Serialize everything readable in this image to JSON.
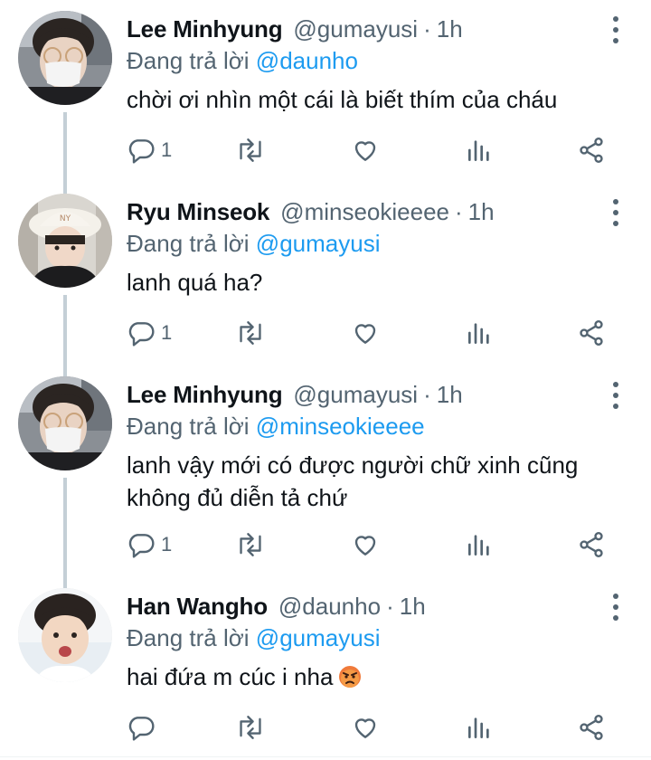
{
  "reply_prefix": "Đang trả lời",
  "dot": "·",
  "tweets": [
    {
      "name": "Lee Minhyung",
      "handle": "@gumayusi",
      "time": "1h",
      "reply_to": "@daunho",
      "text": "chời ơi nhìn một cái là biết thím của cháu",
      "reply_count": "1",
      "avatar": "photo-masked-glasses"
    },
    {
      "name": "Ryu Minseok",
      "handle": "@minseokieeee",
      "time": "1h",
      "reply_to": "@gumayusi",
      "text": "lanh quá ha?",
      "reply_count": "1",
      "avatar": "photo-bucket-hat"
    },
    {
      "name": "Lee Minhyung",
      "handle": "@gumayusi",
      "time": "1h",
      "reply_to": "@minseokieeee",
      "text": "lanh vậy mới có được người chữ xinh cũng không đủ diễn tả chứ",
      "reply_count": "1",
      "avatar": "photo-masked-glasses"
    },
    {
      "name": "Han Wangho",
      "handle": "@daunho",
      "time": "1h",
      "reply_to": "@gumayusi",
      "text": "hai đứa m cúc i nha",
      "reply_count": "",
      "avatar": "photo-selfie",
      "emoji": "angry-face-emoji"
    }
  ],
  "colors": {
    "accent": "#1d9bf0",
    "secondary_text": "#536471",
    "thread_line": "#c4cfd6"
  }
}
